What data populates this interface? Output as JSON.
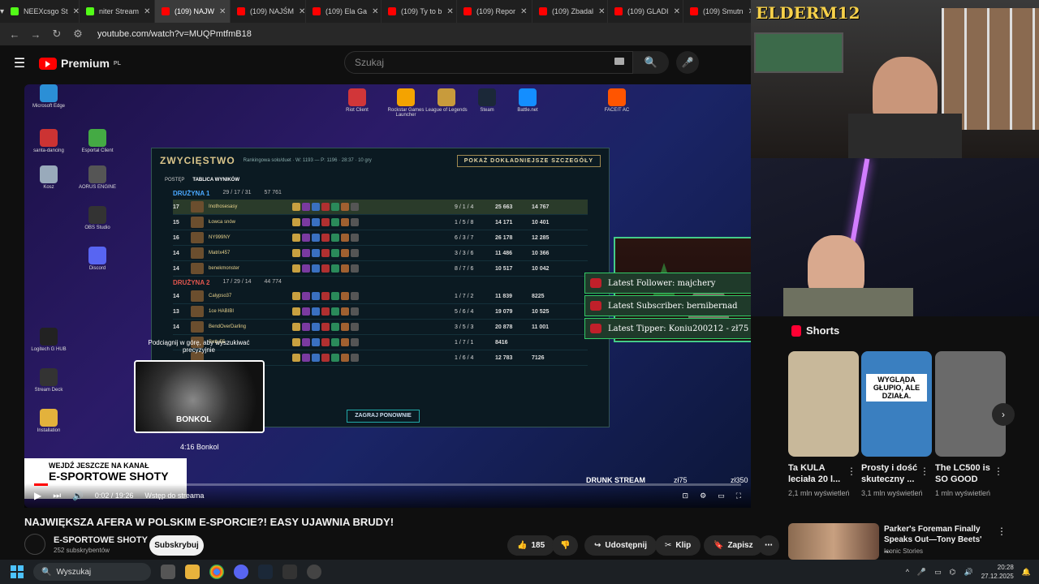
{
  "browser": {
    "tabs": [
      {
        "label": "NEEXcsgo St",
        "color": "#53fc18",
        "active": false
      },
      {
        "label": "niter Stream",
        "color": "#53fc18",
        "active": false
      },
      {
        "label": "(109) NAJW",
        "color": "#ff0000",
        "active": true
      },
      {
        "label": "(109) NAJŚM",
        "color": "#ff0000",
        "active": false
      },
      {
        "label": "(109) Ela Ga",
        "color": "#ff0000",
        "active": false
      },
      {
        "label": "(109) Ty to b",
        "color": "#ff0000",
        "active": false
      },
      {
        "label": "(109) Repor",
        "color": "#ff0000",
        "active": false
      },
      {
        "label": "(109) Zbadal",
        "color": "#ff0000",
        "active": false
      },
      {
        "label": "(109) GLADI",
        "color": "#ff0000",
        "active": false
      },
      {
        "label": "(109) Smutn",
        "color": "#ff0000",
        "active": false
      }
    ],
    "url": "youtube.com/watch?v=MUQPmtfmB18"
  },
  "yt": {
    "logo_text": "Premium",
    "logo_region": "PL",
    "search_placeholder": "Szukaj"
  },
  "desktop_icons": [
    {
      "label": "Microsoft Edge",
      "color": "#2b8fd6"
    },
    {
      "label": "santa-dancing",
      "color": "#c33"
    },
    {
      "label": "Kosz",
      "color": "#9ab"
    },
    {
      "label": "Logitech G HUB",
      "color": "#222"
    },
    {
      "label": "Stream Deck",
      "color": "#333"
    },
    {
      "label": "Installation",
      "color": "#e3b23c"
    },
    {
      "label": "Esportal Client",
      "color": "#4a4"
    },
    {
      "label": "AORUS ENGINE",
      "color": "#555"
    },
    {
      "label": "OBS Studio",
      "color": "#333"
    },
    {
      "label": "Discord",
      "color": "#5865f2"
    },
    {
      "label": "Riot Client",
      "color": "#d13639"
    },
    {
      "label": "Rockstar Games Launcher",
      "color": "#f4a300"
    },
    {
      "label": "League of Legends",
      "color": "#c89b3c"
    },
    {
      "label": "Steam",
      "color": "#1b2838"
    },
    {
      "label": "Battle.net",
      "color": "#148eff"
    },
    {
      "label": "FACEIT AC",
      "color": "#ff5500"
    }
  ],
  "lol": {
    "title": "ZWYCIĘSTWO",
    "subtitle": "Rankingowa solo/duet · W: 1193 — P: 1196 · 28:37 · 10 gry",
    "detail_button": "POKAŻ DOKŁADNIEJSZE SZCZEGÓŁY",
    "tabs": [
      "POSTĘP",
      "TABLICA WYNIKÓW"
    ],
    "team1": {
      "label": "DRUŻYNA 1",
      "kda": "29 / 17 / 31",
      "gold": "57 761"
    },
    "team2": {
      "label": "DRUŻYNA 2",
      "kda": "17 / 29 / 14",
      "gold": "44 774"
    },
    "players1": [
      {
        "lvl": "17",
        "name": "Inothosesasy",
        "kda": "9 / 1 / 4",
        "dmg": "25 663",
        "gold": "14 767"
      },
      {
        "lvl": "15",
        "name": "Łowca snów",
        "kda": "1 / 5 / 8",
        "dmg": "14 171",
        "gold": "10 401"
      },
      {
        "lvl": "16",
        "name": "NY999NY",
        "kda": "6 / 3 / 7",
        "dmg": "26 178",
        "gold": "12 285"
      },
      {
        "lvl": "14",
        "name": "Matrix457",
        "kda": "3 / 3 / 6",
        "dmg": "11 486",
        "gold": "10 366"
      },
      {
        "lvl": "14",
        "name": "benekmonster",
        "kda": "8 / 7 / 6",
        "dmg": "10 517",
        "gold": "10 042"
      }
    ],
    "players2": [
      {
        "lvl": "14",
        "name": "Calypso37",
        "kda": "1 / 7 / 2",
        "dmg": "11 839",
        "gold": "8225"
      },
      {
        "lvl": "13",
        "name": "1ce HABIBI",
        "kda": "5 / 6 / 4",
        "dmg": "19 079",
        "gold": "10 525"
      },
      {
        "lvl": "14",
        "name": "BendOverDarling",
        "kda": "3 / 5 / 3",
        "dmg": "20 878",
        "gold": "11 001"
      },
      {
        "lvl": "",
        "name": "Betty55",
        "kda": "1 / 7 / 1",
        "dmg": "8416",
        "gold": ""
      },
      {
        "lvl": "",
        "name": "",
        "kda": "1 / 6 / 4",
        "dmg": "12 783",
        "gold": "7126"
      }
    ],
    "play_again": "ZAGRAJ PONOWNIE"
  },
  "alerts": [
    "Latest Follower: majchery",
    "Latest Subscriber: bernibernad",
    "Latest Tipper: Koniu200212 - zł75"
  ],
  "streamer": "ELDERM12",
  "player_overlay": {
    "tooltip": "Podciągnij w górę, aby wyszukiwać precyzyjnie",
    "preview_label": "BONKOL",
    "preview_time": "4:16  Bonkol",
    "endcard_line1": "WEJDŹ JESZCZE NA KANAŁ",
    "endcard_line2": "E-SPORTOWE SHOTY",
    "time": "0:02 / 19:26",
    "intro_label": "Wstęp do streama",
    "progress": 0.02,
    "overlay_drunk": "DRUNK STREAM",
    "overlay_zl1": "zł75",
    "overlay_zl2": "zł350"
  },
  "video": {
    "title": "NAJWIĘKSZA AFERA W POLSKIM E-SPORCIE?! EASY UJAWNIA BRUDY!",
    "channel": "E-SPORTOWE SHOTY",
    "subscribers": "252 subskrybentów",
    "subscribe": "Subskrybuj",
    "likes": "185",
    "share": "Udostępnij",
    "clip": "Klip",
    "save": "Zapisz"
  },
  "shorts": {
    "header": "Shorts",
    "items": [
      {
        "title": "Ta KULA leciała 20 l...",
        "views": "2,1 mln wyświetleń",
        "bg": "#c8b89a"
      },
      {
        "title": "Prosty i dość skuteczny ...",
        "views": "3,1 mln wyświetleń",
        "bg": "#3a7fc0",
        "overlay": "WYGLĄDA GŁUPIO, ALE DZIAŁA."
      },
      {
        "title": "The LC500 is SO GOOD",
        "views": "1 mln wyświetleń",
        "bg": "#6a6a6a"
      }
    ]
  },
  "recommended": {
    "title": "Parker's Foreman Finally Speaks Out—Tony Beets' ...",
    "channel": "Iconic Stories"
  },
  "taskbar": {
    "search": "Wyszukaj",
    "time": "20:28",
    "date": "27.12.2025"
  }
}
